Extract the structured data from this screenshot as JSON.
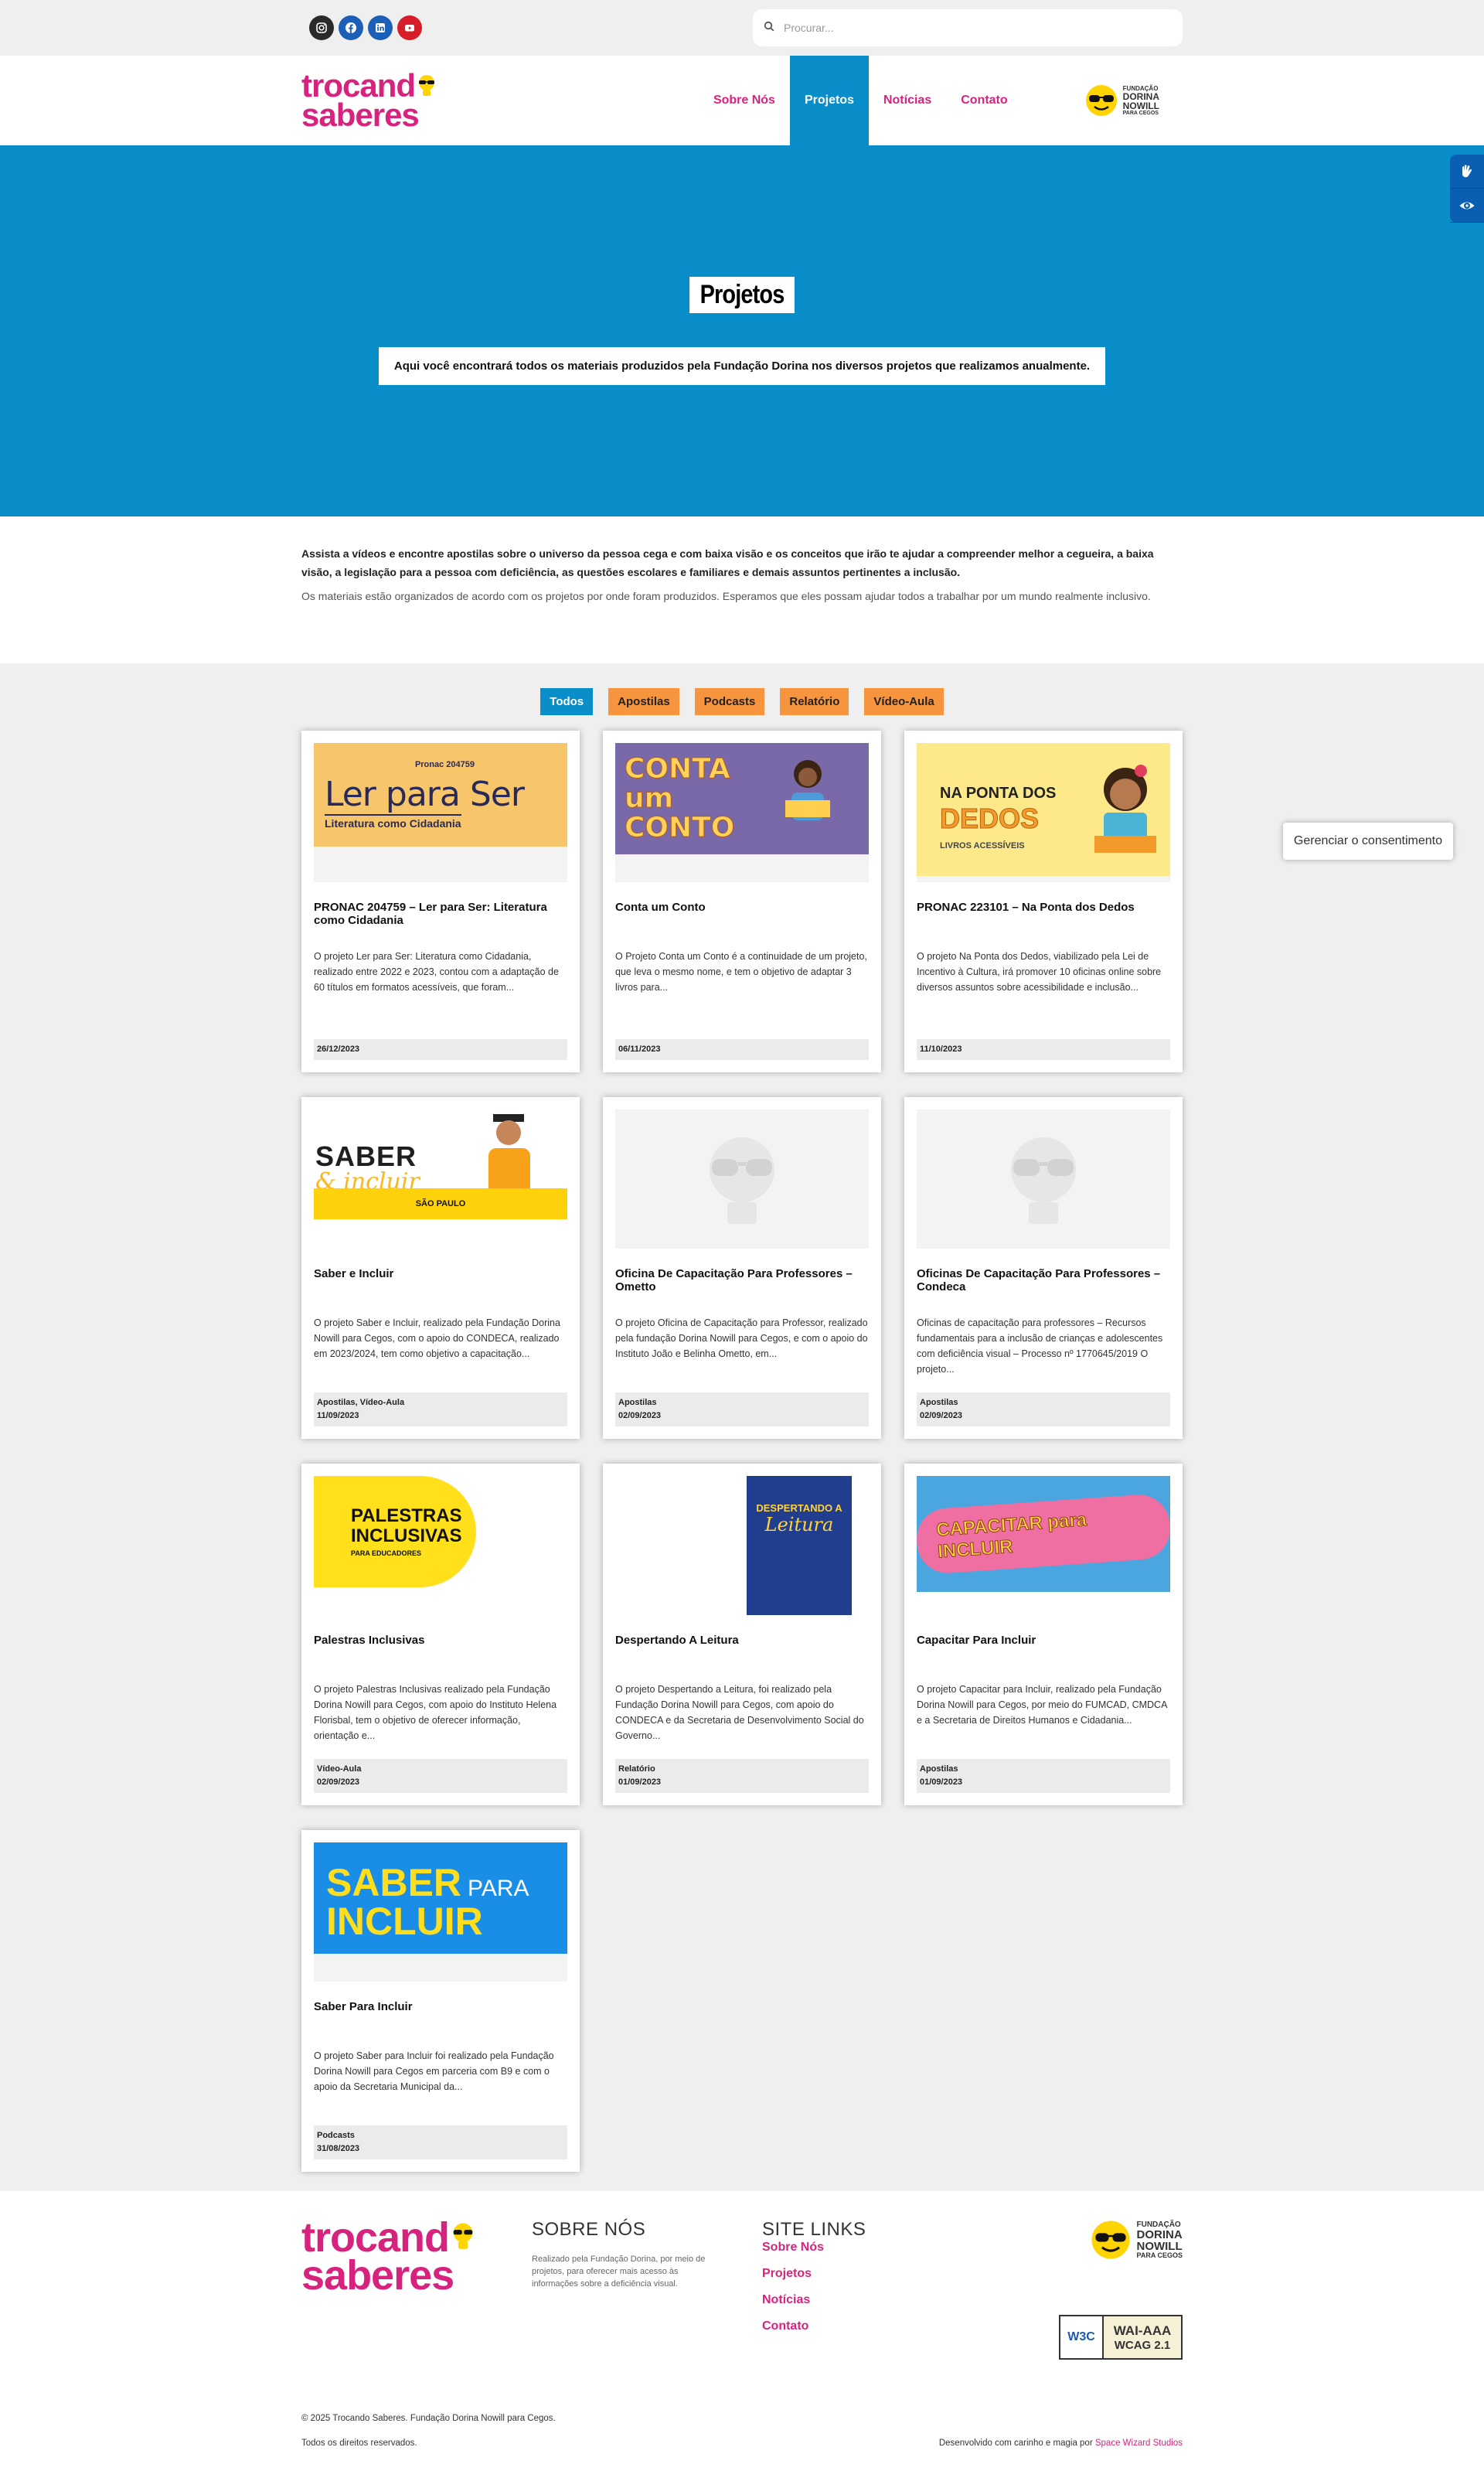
{
  "search": {
    "placeholder": "Procurar..."
  },
  "social": {
    "instagram": "instagram-icon",
    "facebook": "facebook-icon",
    "linkedin": "linkedin-icon",
    "youtube": "youtube-icon"
  },
  "logo": {
    "line1": "trocand",
    "line2": "saberes"
  },
  "nav": {
    "items": [
      "Sobre Nós",
      "Projetos",
      "Notícias",
      "Contato"
    ],
    "active": "Projetos"
  },
  "dorina": {
    "l1": "FUNDAÇÃO",
    "l2": "DORINA",
    "l3": "NOWILL",
    "l4": "PARA CEGOS"
  },
  "hero": {
    "title": "Projetos",
    "subtitle": "Aqui você encontrará todos os materiais produzidos pela Fundação Dorina nos diversos projetos que realizamos anualmente."
  },
  "intro": {
    "bold": "Assista a vídeos e encontre apostilas sobre o universo da pessoa cega e com baixa visão e os conceitos que irão te ajudar a compreender melhor a cegueira, a baixa visão, a legislação para a pessoa com deficiência, as questões escolares e familiares e demais assuntos pertinentes a inclusão.",
    "regular": "Os materiais estão organizados de acordo com os projetos por onde foram produzidos. Esperamos que eles possam ajudar todos a trabalhar por um mundo realmente inclusivo."
  },
  "filters": [
    "Todos",
    "Apostilas",
    "Podcasts",
    "Relatório",
    "Vídeo-Aula"
  ],
  "cards": [
    {
      "title": "PRONAC 204759 – Ler para Ser: Literatura como Cidadania",
      "excerpt": "O projeto Ler para Ser: Literatura como Cidadania, realizado entre 2022 e 2023, contou com a adaptação de 60 títulos em formatos acessíveis, que foram...",
      "category": "",
      "date": "26/12/2023",
      "thumb_text": "Ler para Ser",
      "thumb_sub": "Literatura como Cidadania",
      "thumb_tag": "Pronac 204759"
    },
    {
      "title": "Conta um Conto",
      "excerpt": "O Projeto Conta um Conto é a continuidade de um projeto, que leva o mesmo nome, e tem o objetivo de adaptar 3 livros para...",
      "category": "",
      "date": "06/11/2023",
      "thumb_text": "CONTA um CONTO"
    },
    {
      "title": "PRONAC 223101 – Na Ponta dos Dedos",
      "excerpt": "O projeto Na Ponta dos Dedos, viabilizado pela Lei de Incentivo à Cultura, irá promover 10 oficinas online sobre diversos assuntos sobre acessibilidade e inclusão...",
      "category": "",
      "date": "11/10/2023",
      "thumb_text": "NA PONTA DOS",
      "thumb_sub": "DEDOS",
      "thumb_tag": "LIVROS ACESSÍVEIS"
    },
    {
      "title": "Saber e Incluir",
      "excerpt": "O projeto Saber e Incluir, realizado pela Fundação Dorina Nowill para Cegos, com o apoio do CONDECA, realizado em 2023/2024, tem como objetivo a capacitação...",
      "category": "Apostilas, Vídeo-Aula",
      "date": "11/09/2023",
      "thumb_text": "SABER",
      "thumb_sub": "& incluir",
      "thumb_tag": "SÃO PAULO"
    },
    {
      "title": "Oficina De Capacitação Para Professores – Ometto",
      "excerpt": "O projeto Oficina de Capacitação para Professor, realizado pela fundação Dorina Nowill para Cegos, e com o apoio do Instituto João e Belinha Ometto, em...",
      "category": "Apostilas",
      "date": "02/09/2023"
    },
    {
      "title": "Oficinas De Capacitação Para Professores – Condeca",
      "excerpt": "Oficinas de capacitação para professores – Recursos fundamentais para a inclusão de crianças e adolescentes com deficiência visual – Processo nº 1770645/2019   O projeto...",
      "category": "Apostilas",
      "date": "02/09/2023"
    },
    {
      "title": "Palestras Inclusivas",
      "excerpt": "O projeto Palestras Inclusivas realizado pela Fundação Dorina Nowill para Cegos, com apoio do Instituto Helena Florisbal, tem o objetivo de oferecer informação, orientação e...",
      "category": "Vídeo-Aula",
      "date": "02/09/2023",
      "thumb_text": "PALESTRAS INCLUSIVAS",
      "thumb_sub": "PARA EDUCADORES"
    },
    {
      "title": "Despertando A Leitura",
      "excerpt": "O projeto Despertando a Leitura, foi realizado pela Fundação Dorina Nowill para Cegos, com apoio do CONDECA e da Secretaria de Desenvolvimento Social do Governo...",
      "category": "Relatório",
      "date": "01/09/2023",
      "thumb_text": "DESPERTANDO A",
      "thumb_sub": "Leitura"
    },
    {
      "title": "Capacitar Para Incluir",
      "excerpt": "O projeto Capacitar para Incluir, realizado pela Fundação Dorina Nowill para Cegos, por meio do FUMCAD, CMDCA e a Secretaria de Direitos Humanos e Cidadania...",
      "category": "Apostilas",
      "date": "01/09/2023",
      "thumb_text": "CAPACITAR para INCLUIR"
    },
    {
      "title": "Saber Para Incluir",
      "excerpt": "O projeto Saber para Incluir foi realizado pela Fundação Dorina Nowill para Cegos em parceria com B9 e com o apoio da Secretaria Municipal da...",
      "category": "Podcasts",
      "date": "31/08/2023",
      "thumb_text": "SABER",
      "thumb_sub": "INCLUIR",
      "thumb_tag": "PARA"
    }
  ],
  "footer": {
    "about_title": "SOBRE NÓS",
    "about_text": "Realizado pela Fundação Dorina, por meio de projetos, para oferecer mais acesso às informações sobre a deficiência visual.",
    "links_title": "SITE LINKS",
    "links": [
      "Sobre Nós",
      "Projetos",
      "Notícias",
      "Contato"
    ],
    "wcag_logo": "W3C",
    "wcag_l1": "WAI-AAA",
    "wcag_l2": "WCAG 2.1",
    "copyright": "© 2025 Trocando Saberes. Fundação Dorina Nowill para Cegos.",
    "rights": "Todos os direitos reservados.",
    "dev_prefix": "Desenvolvido com carinho e magia por",
    "dev_link": "Space Wizard Studios"
  },
  "consent": "Gerenciar o consentimento",
  "accessibility": {
    "libras": "sign-language-icon",
    "view": "eye-icon"
  },
  "colors": {
    "brand_pink": "#d8237e",
    "brand_blue": "#0a8ec9",
    "filter_orange": "#f7953f",
    "dorina_yellow": "#ffd400"
  }
}
